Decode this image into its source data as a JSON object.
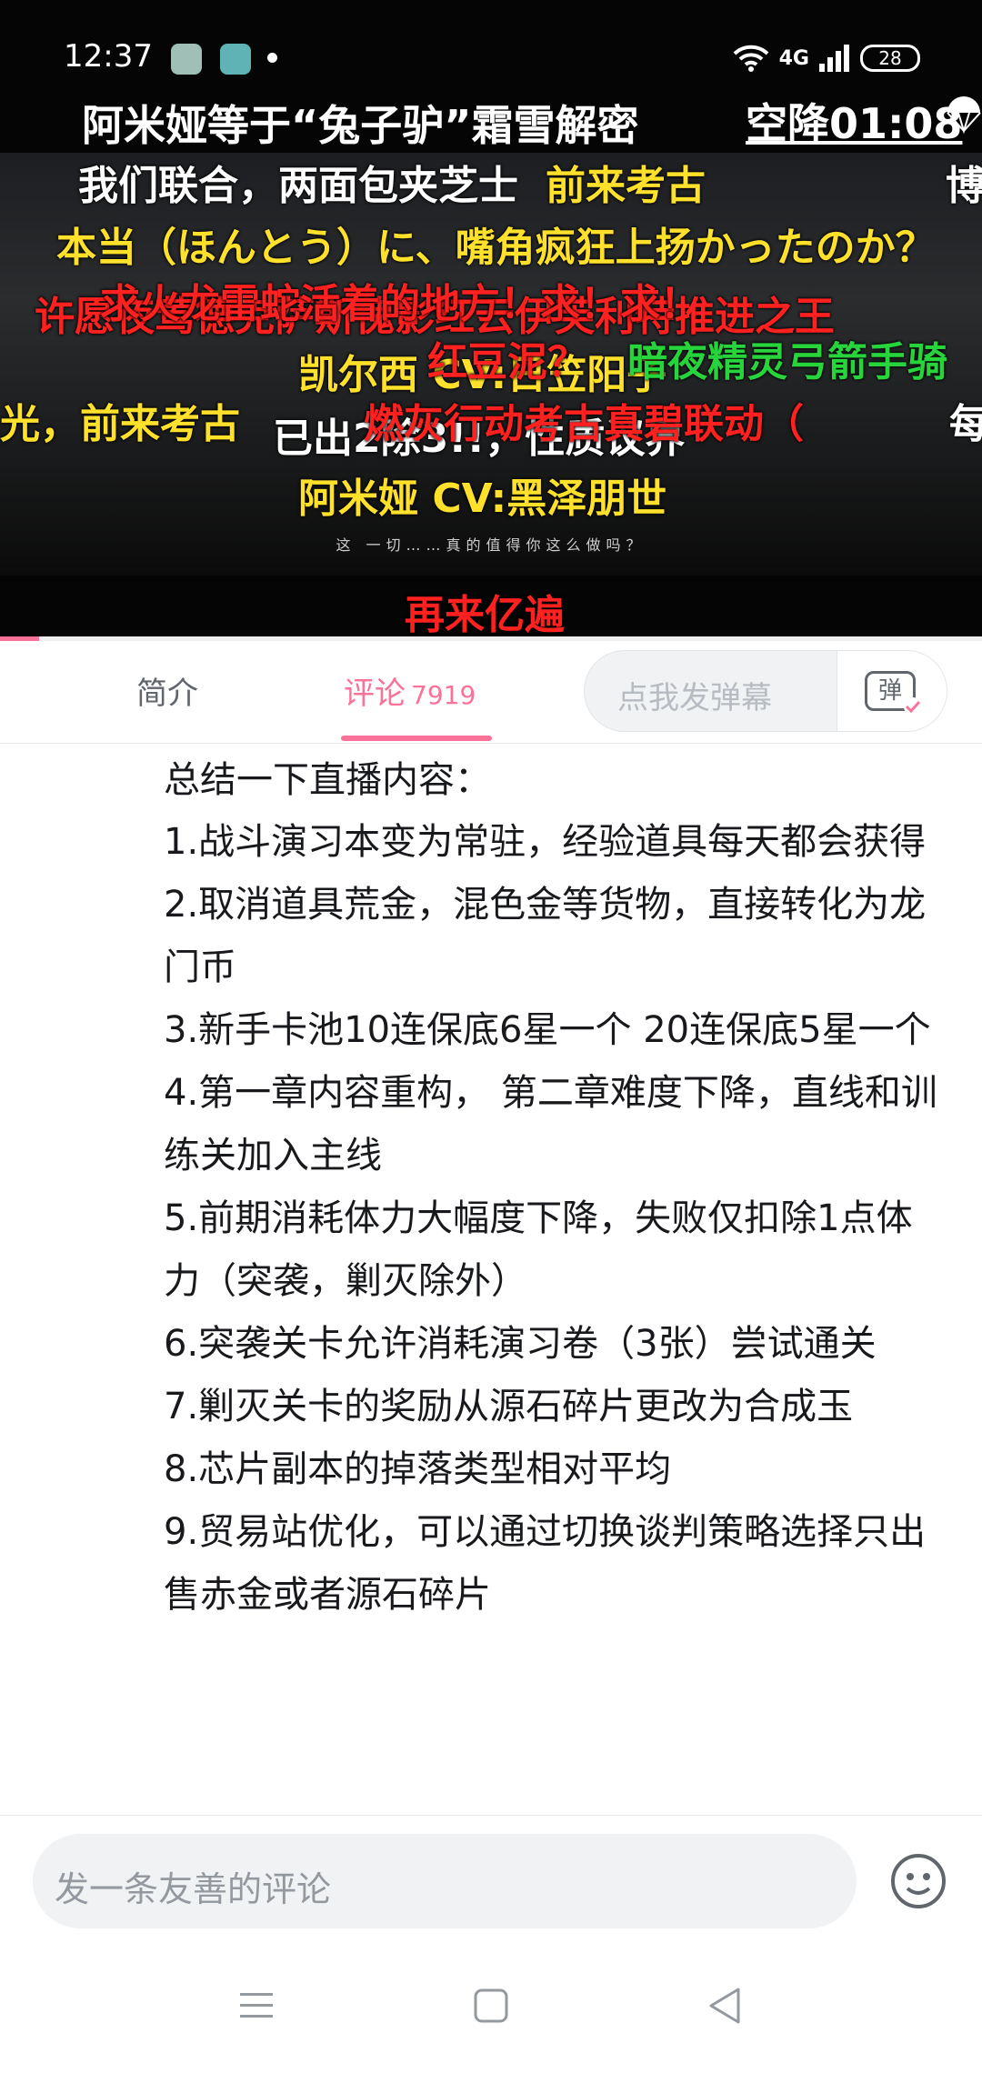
{
  "status_bar": {
    "time": "12:37",
    "network": "4G",
    "battery": "28"
  },
  "video": {
    "title": "阿米娅等于“兔子驴”霜雪解密",
    "airdrop": "空降01:08",
    "quote": "这 一切……真的值得你这么做吗？",
    "progress": 0.04,
    "danmaku": [
      {
        "text": "我们联合，两面包夹芝士",
        "color": "white"
      },
      {
        "text": "前来考古",
        "color": "yellow"
      },
      {
        "text": "博",
        "color": "white"
      },
      {
        "text": "本当（ほんとう）に、嘴角疯狂上扬かったのか？",
        "color": "yellow"
      },
      {
        "text": "许愿夜莺德克萨斯傀影红云伊芙利特推进之王",
        "color": "red"
      },
      {
        "text": "求火龙雷蛇活着的地方！求！求！",
        "color": "red"
      },
      {
        "text": "凯尔西 CV:日笠阳子",
        "color": "yellow"
      },
      {
        "text": "红豆泥？",
        "color": "red"
      },
      {
        "text": "暗夜精灵弓箭手骑",
        "color": "green"
      },
      {
        "text": "光，前来考古",
        "color": "yellow"
      },
      {
        "text": "已出2除3!!，性质议界",
        "color": "white"
      },
      {
        "text": "燃灰行动考古真碧联动（",
        "color": "red"
      },
      {
        "text": "每",
        "color": "white"
      },
      {
        "text": "阿米娅 CV:黑泽朋世",
        "color": "yellow"
      },
      {
        "text": "再来亿遍",
        "color": "red"
      }
    ]
  },
  "tabs": {
    "intro": "简介",
    "comments": "评论",
    "comments_count": "7919",
    "danmaku_placeholder": "点我发弹幕",
    "danmaku_button": "弹"
  },
  "comment": {
    "title": "总结一下直播内容：",
    "items": [
      "1.战斗演习本变为常驻，经验道具每天都会获得",
      "2.取消道具荒金，混色金等货物，直接转化为龙门币",
      "3.新手卡池10连保底6星一个 20连保底5星一个",
      "4.第一章内容重构， 第二章难度下降，直线和训练关加入主线",
      "5.前期消耗体力大幅度下降，失败仅扣除1点体力（突袭，剿灭除外）",
      "6.突袭关卡允许消耗演习卷（3张）尝试通关",
      "7.剿灭关卡的奖励从源石碎片更改为合成玉",
      "8.芯片副本的掉落类型相对平均",
      "9.贸易站优化，可以通过切换谈判策略选择只出售赤金或者源石碎片"
    ]
  },
  "composer": {
    "placeholder": "发一条友善的评论"
  },
  "colors": {
    "accent": "#fb7299",
    "text": "#18191c",
    "muted": "#61666d"
  },
  "icons": [
    "wifi-icon",
    "signal-icon",
    "battery-icon",
    "parachute-icon",
    "danmaku-tv-icon",
    "emoji-icon",
    "menu-icon",
    "home-square-icon",
    "back-triangle-icon"
  ]
}
